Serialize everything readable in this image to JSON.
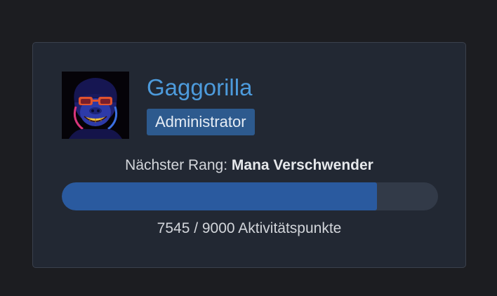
{
  "profile": {
    "username": "Gaggorilla",
    "role": "Administrator",
    "avatar_icon": "gorilla-with-sunglasses-icon"
  },
  "rank": {
    "next_label": "Nächster Rang:",
    "next_name": "Mana Verschwender",
    "current_points": 7545,
    "target_points": 9000,
    "progress_fraction": 0.838,
    "points_text": "7545 / 9000 Aktivitätspunkte"
  },
  "colors": {
    "background": "#1c1d21",
    "card": "#222833",
    "username": "#4d9bdc",
    "badge": "#2d5a8e",
    "progress_fill": "#2a5a9f",
    "progress_track": "#323a48"
  }
}
